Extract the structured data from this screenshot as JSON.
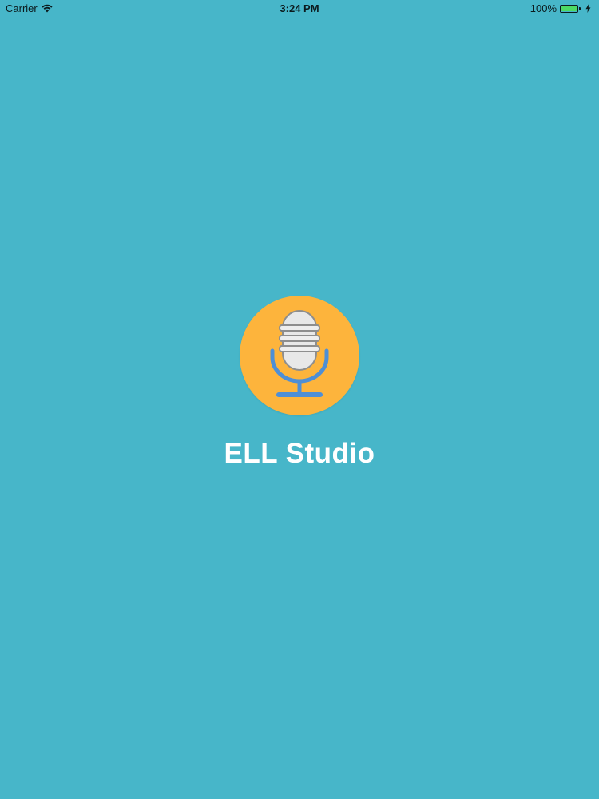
{
  "status_bar": {
    "carrier": "Carrier",
    "time": "3:24 PM",
    "battery_percent": "100%",
    "battery_level": 1.0,
    "wifi_icon": "wifi-icon",
    "battery_icon": "battery-icon",
    "charging_icon": "charging-bolt-icon"
  },
  "splash": {
    "logo_icon": "microphone-icon",
    "app_name": "ELL Studio"
  },
  "colors": {
    "background": "#47b6c9",
    "logo_circle": "#fdb43c",
    "mic_stand": "#4e8fd6",
    "mic_head": "#e8e8e8",
    "app_name_text": "#ffffff",
    "battery_fill": "#4cd964"
  }
}
